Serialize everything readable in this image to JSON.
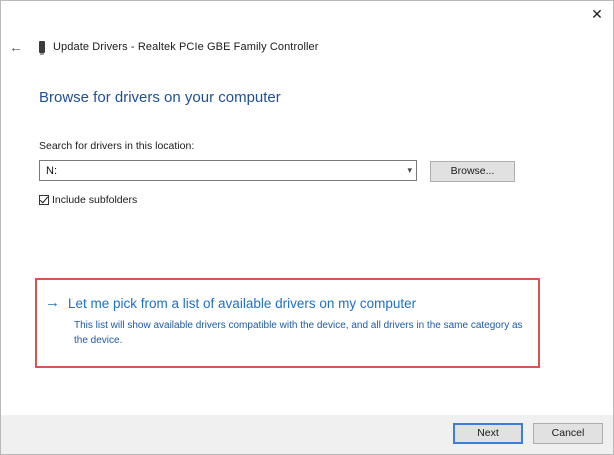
{
  "window": {
    "close_glyph": "✕",
    "back_glyph": "←",
    "title": "Update Drivers - Realtek PCIe GBE Family Controller"
  },
  "main": {
    "heading": "Browse for drivers on your computer",
    "search_label": "Search for drivers in this location:",
    "path_value": "N:",
    "combo_caret": "▾",
    "browse_label": "Browse...",
    "include_subfolders_label": "Include subfolders",
    "include_subfolders_checked": true
  },
  "pick_option": {
    "arrow_glyph": "→",
    "title": "Let me pick from a list of available drivers on my computer",
    "description": "This list will show available drivers compatible with the device, and all drivers in the same category as the device."
  },
  "footer": {
    "next_label": "Next",
    "cancel_label": "Cancel"
  },
  "colors": {
    "heading": "#1e4f97",
    "link": "#1e6fc8",
    "highlight_border": "#d9534f",
    "default_button_border": "#3c7fd9",
    "footer_bg": "#f0f0f0"
  }
}
